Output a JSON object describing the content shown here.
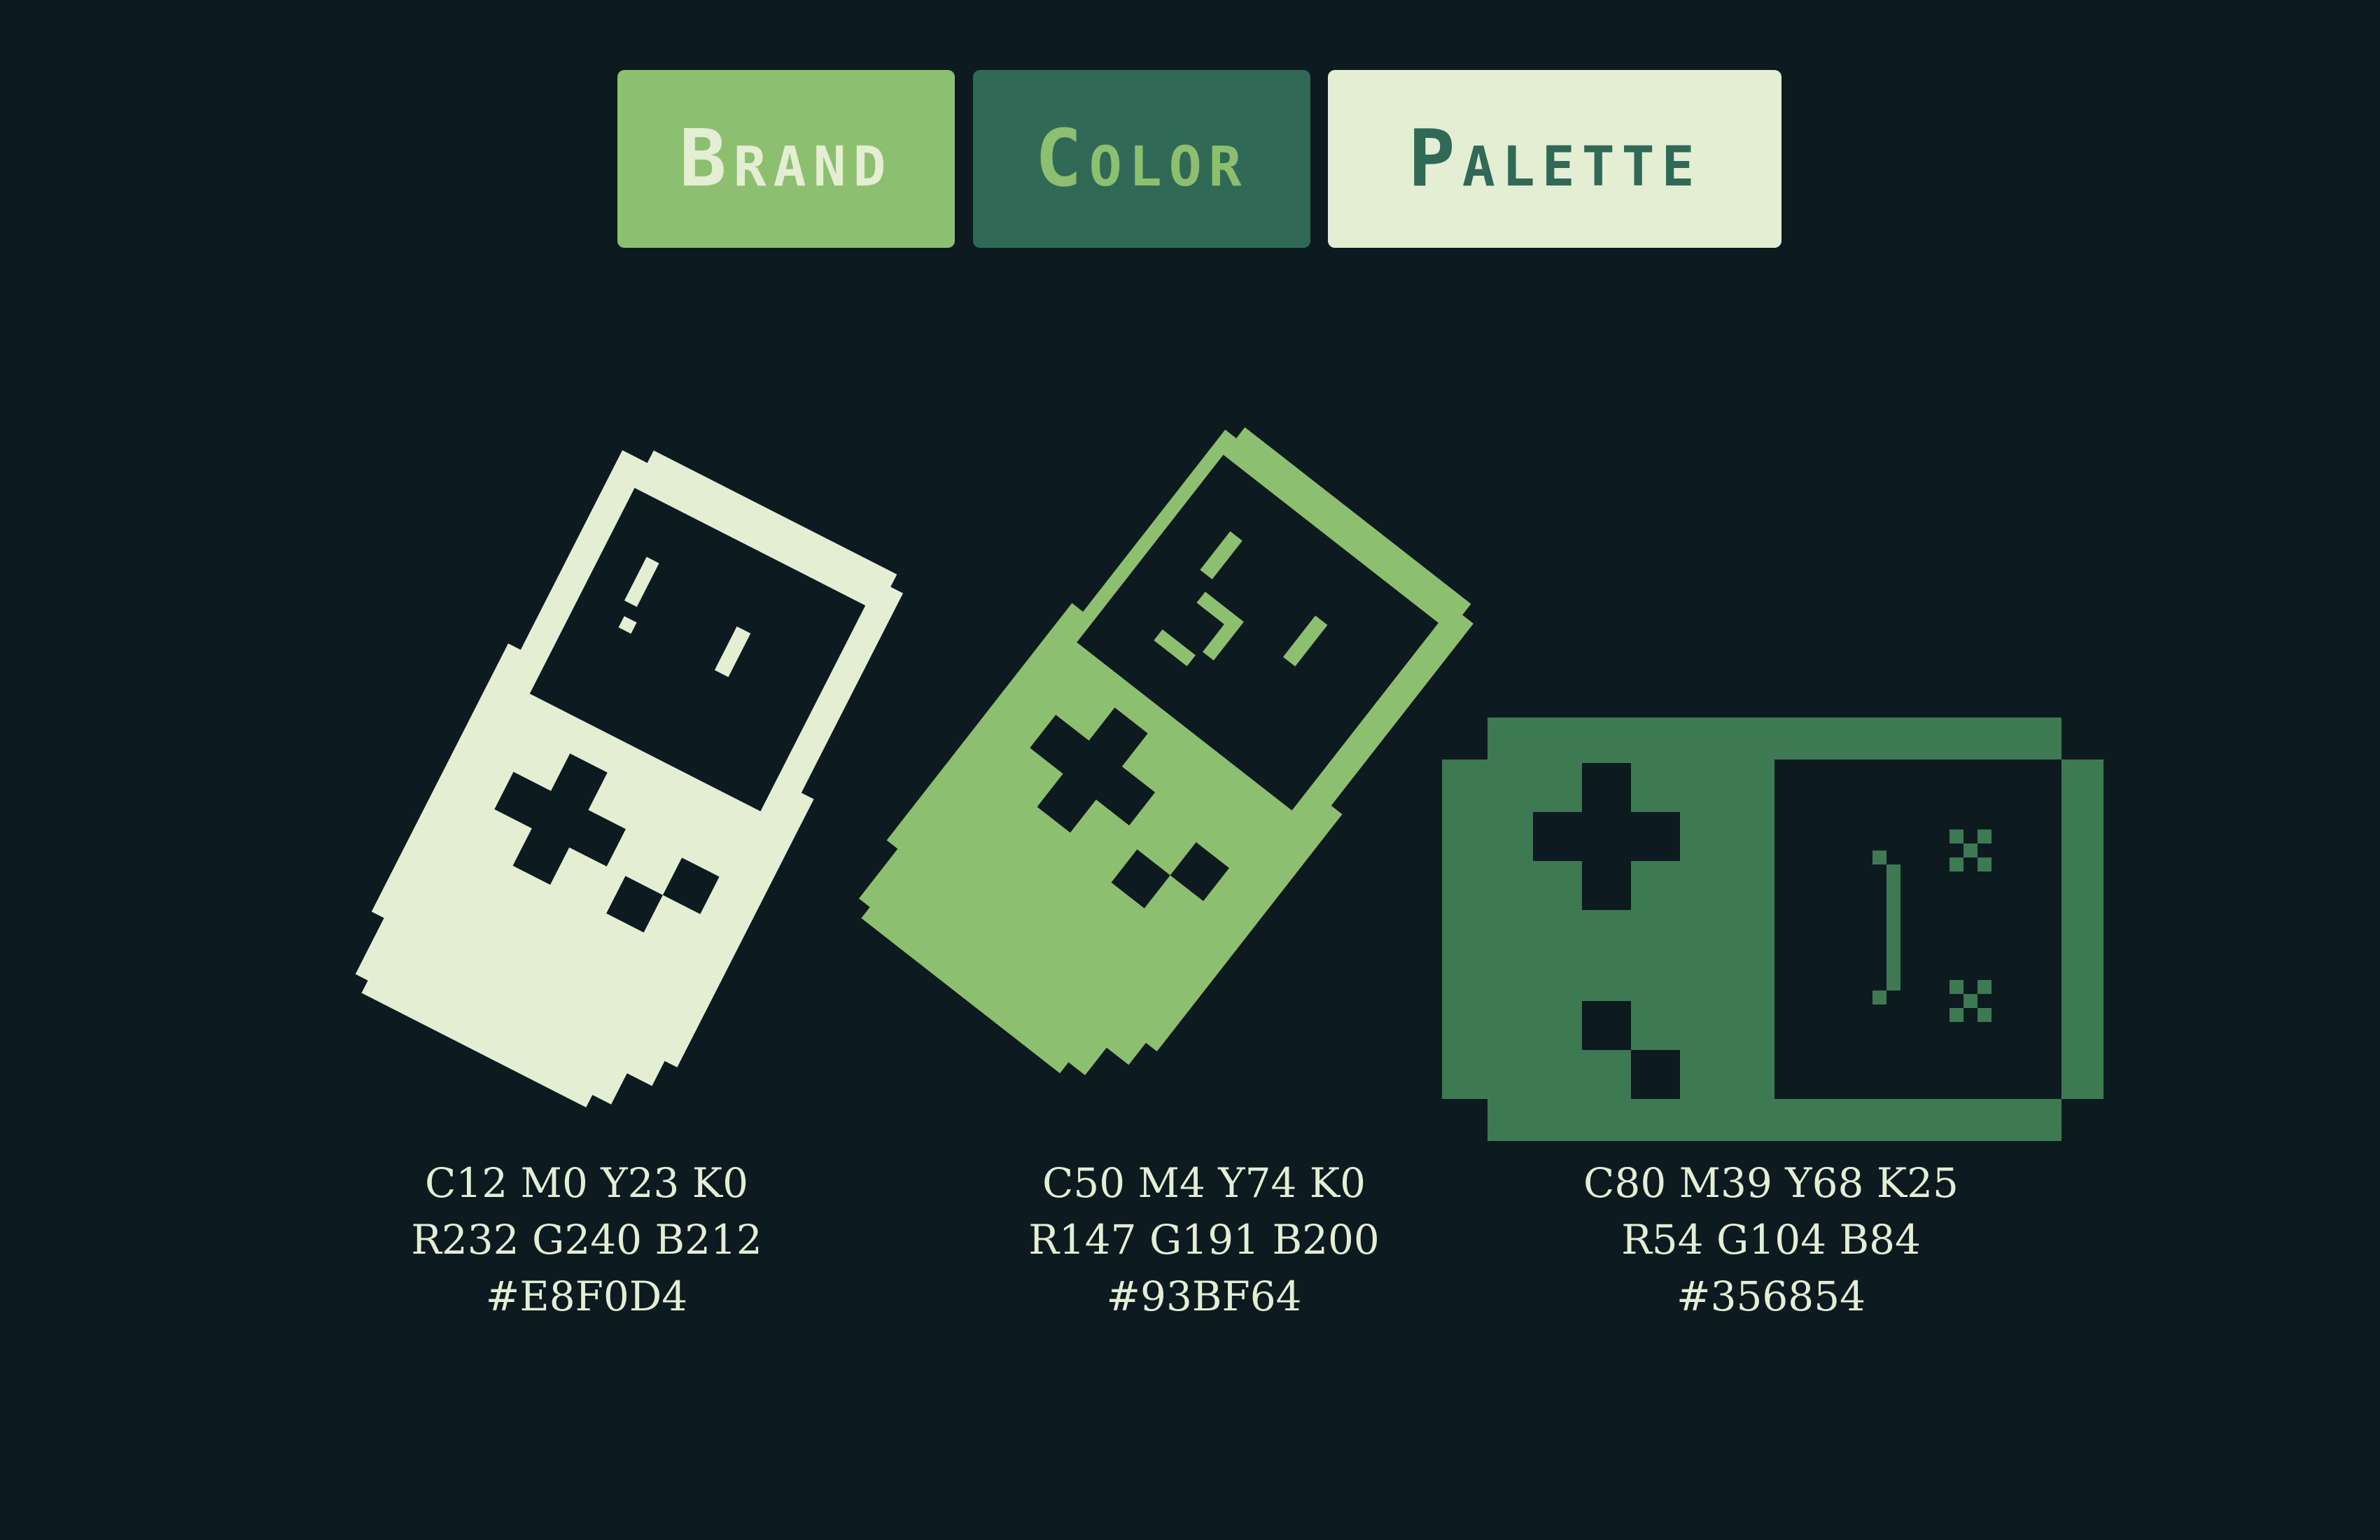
{
  "title": {
    "words": [
      "Brand",
      "Color",
      "Palette"
    ]
  },
  "colors": {
    "background": "#0D1A20",
    "light": "#E8F0D4",
    "mid": "#93BF64",
    "dark": "#356854"
  },
  "swatches": [
    {
      "cmyk": "C12 M0 Y23 K0",
      "rgb": "R232 G240 B212",
      "hex": "#E8F0D4",
      "icon": "tilted-handheld-console-icon"
    },
    {
      "cmyk": "C50 M4 Y74 K0",
      "rgb": "R147 G191 B200",
      "hex": "#93BF64",
      "icon": "winking-handheld-console-icon"
    },
    {
      "cmyk": "C80 M39 Y68 K25",
      "rgb": "R54 G104 B84",
      "hex": "#356854",
      "icon": "sideways-handheld-console-icon"
    }
  ]
}
